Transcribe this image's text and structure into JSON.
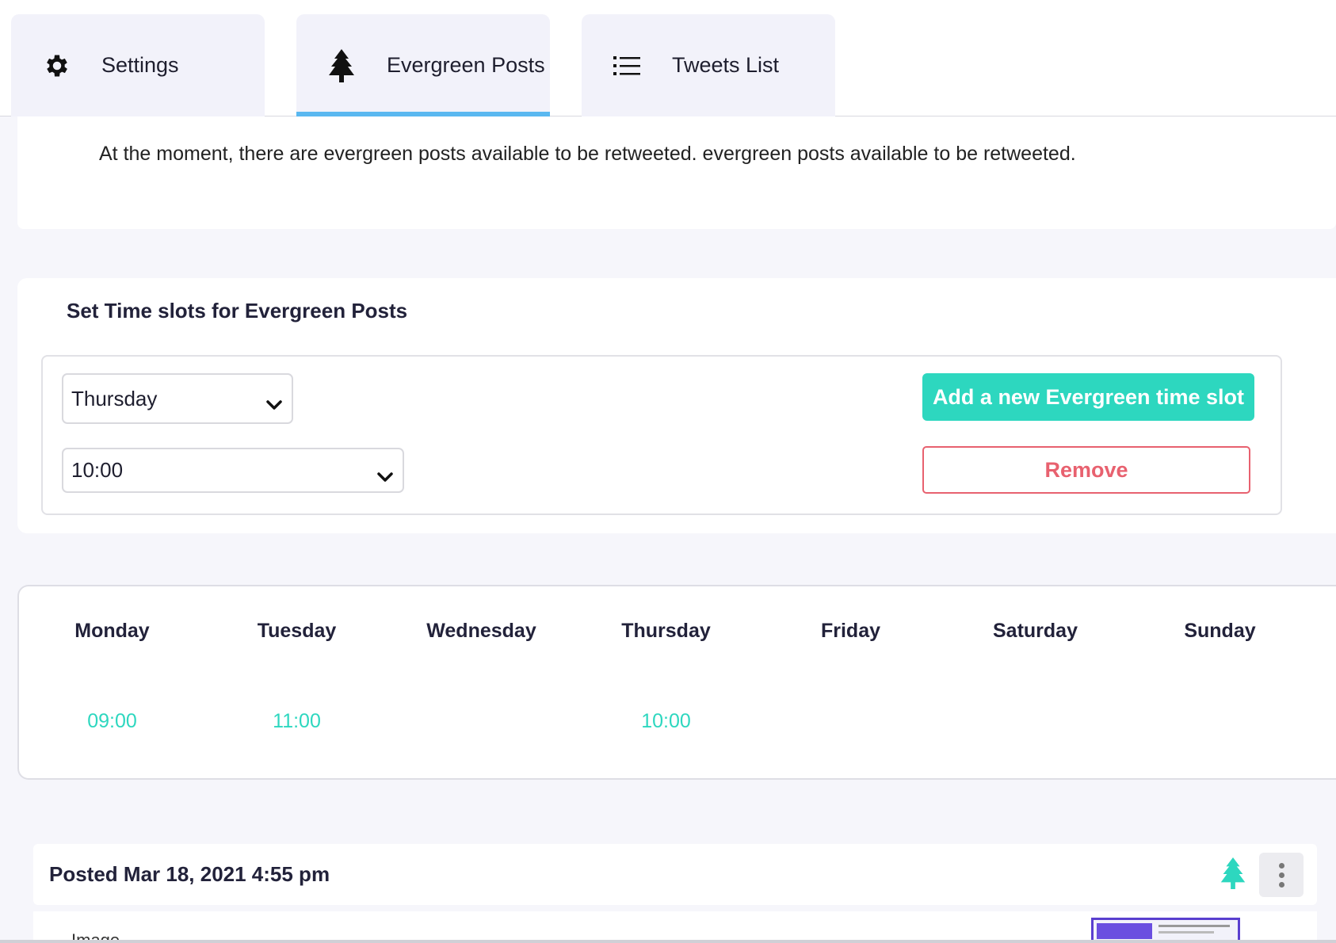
{
  "tabs": [
    {
      "label": "Settings",
      "icon": "gear-icon"
    },
    {
      "label": "Evergreen Posts",
      "icon": "tree-icon",
      "active": true
    },
    {
      "label": "Tweets List",
      "icon": "list-icon"
    }
  ],
  "info": {
    "text": "At the moment, there are  evergreen posts available to be retweeted. evergreen posts available to be retweeted."
  },
  "time_slots": {
    "title": "Set Time slots for Evergreen Posts",
    "day_value": "Thursday",
    "time_value": "10:00",
    "add_label": "Add a new Evergreen time slot",
    "remove_label": "Remove"
  },
  "week": [
    {
      "day": "Monday",
      "time": "09:00"
    },
    {
      "day": "Tuesday",
      "time": "11:00"
    },
    {
      "day": "Wednesday",
      "time": ""
    },
    {
      "day": "Thursday",
      "time": "10:00"
    },
    {
      "day": "Friday",
      "time": ""
    },
    {
      "day": "Saturday",
      "time": ""
    },
    {
      "day": "Sunday",
      "time": ""
    }
  ],
  "post": {
    "date_label": "Posted Mar 18, 2021 4:55 pm",
    "body_label": "Image"
  },
  "colors": {
    "accent": "#2dd7bf",
    "danger": "#e8616f",
    "tab_active": "#5ab8f0"
  }
}
